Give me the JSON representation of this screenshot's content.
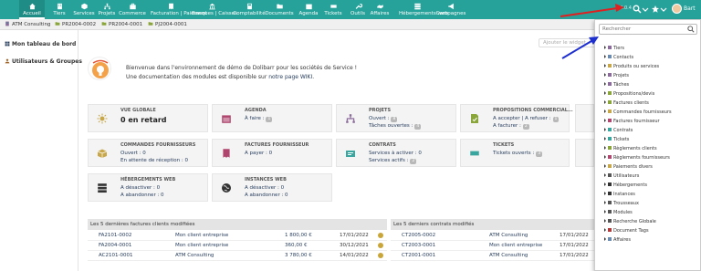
{
  "menu": [
    {
      "label": "Accueil",
      "icon": "home-icon",
      "active": true
    },
    {
      "label": "Tiers",
      "icon": "building-icon"
    },
    {
      "label": "Services",
      "icon": "cube-icon"
    },
    {
      "label": "Projets",
      "icon": "sitemap-icon"
    },
    {
      "label": "Commerce",
      "icon": "briefcase-icon"
    },
    {
      "label": "Facturation | Paiement",
      "icon": "invoice-icon"
    },
    {
      "label": "Banques | Caisses",
      "icon": "bank-icon"
    },
    {
      "label": "Comptabilité",
      "icon": "calculator-icon"
    },
    {
      "label": "Documents",
      "icon": "folder-icon"
    },
    {
      "label": "Agenda",
      "icon": "calendar-icon"
    },
    {
      "label": "Tickets",
      "icon": "ticket-icon"
    },
    {
      "label": "Outils",
      "icon": "wrench-icon"
    },
    {
      "label": "Affaires",
      "icon": "handshake-icon"
    },
    {
      "label": "Hébergements web",
      "icon": "server-icon"
    },
    {
      "label": "Campagnes",
      "icon": "megaphone-icon"
    }
  ],
  "topright": {
    "version": "14.0.4",
    "user": "Bart"
  },
  "breadcrumbs": [
    {
      "label": "ATM Consulting",
      "icon": "building-icon"
    },
    {
      "label": "PR2004-0002",
      "icon": "folder-icon"
    },
    {
      "label": "PR2004-0001",
      "icon": "folder-icon"
    },
    {
      "label": "PJ2004-0001",
      "icon": "folder-icon"
    }
  ],
  "left_menu": [
    {
      "label": "Mon tableau de bord",
      "icon": "dashboard-icon"
    },
    {
      "label": "Utilisateurs & Groupes",
      "icon": "user-icon"
    }
  ],
  "add_widget": "Ajouter le widget...",
  "welcome": {
    "line1": "Bienvenue dans l'environnement de démo de Dolibarr pour les sociétés de Service !",
    "line2_pre": "Une documentation des modules est disponible sur ",
    "line2_link": "notre page WIKI",
    "line2_post": "."
  },
  "cards_row1": [
    {
      "title": "VUE GLOBALE",
      "big": "0 en retard",
      "lines": [],
      "icon": "sun-icon",
      "color": "#c8a74a"
    },
    {
      "title": "AGENDA",
      "lines": [
        {
          "text": "À faire :",
          "badge": "1"
        }
      ],
      "icon": "calendar-icon",
      "color": "#b0466e"
    },
    {
      "title": "PROJETS",
      "lines": [
        {
          "text": "Ouvert :",
          "badge": "8"
        },
        {
          "text": "Tâches ouvertes :",
          "badge": "4"
        }
      ],
      "icon": "sitemap-icon",
      "color": "#8a6b9a"
    },
    {
      "title": "PROPOSITIONS COMMERCIAL...",
      "lines": [
        {
          "text": "A accepter | A refuser :",
          "badge": "1"
        },
        {
          "text": "A facturer :",
          "badge": "2"
        }
      ],
      "icon": "proposal-icon",
      "color": "#8aa63a"
    }
  ],
  "cards_row2": [
    {
      "title": "COMMANDES FOURNISSEURS",
      "lines": [
        {
          "text": "Ouvert : 0"
        },
        {
          "text": "En attente de réception : 0"
        }
      ],
      "icon": "box-icon",
      "color": "#c8a74a"
    },
    {
      "title": "FACTURES FOURNISSEUR",
      "lines": [
        {
          "text": "A payer : 0"
        }
      ],
      "icon": "invoice-icon",
      "color": "#b0466e"
    },
    {
      "title": "CONTRATS",
      "lines": [
        {
          "text": "Services à activer : 0"
        },
        {
          "text": "Services actifs :",
          "badge": "2"
        }
      ],
      "icon": "contract-icon",
      "color": "#3aa6a0"
    },
    {
      "title": "TICKETS",
      "lines": [
        {
          "text": "Tickets ouverts :",
          "badge": "3"
        }
      ],
      "icon": "ticket-icon",
      "color": "#3aa6a0"
    }
  ],
  "cards_row3": [
    {
      "title": "HÉBERGEMENTS WEB",
      "lines": [
        {
          "text": "A désactiver : 0"
        },
        {
          "text": "A abandonner : 0"
        }
      ],
      "icon": "server-icon",
      "color": "#333333"
    },
    {
      "title": "INSTANCES WEB",
      "lines": [
        {
          "text": "A désactiver : 0"
        },
        {
          "text": "A abandonner : 0"
        }
      ],
      "icon": "globe-icon",
      "color": "#333333"
    }
  ],
  "invoices": {
    "title": "Les 5 dernières factures clients modifiées",
    "rows": [
      {
        "ref": "FA2101-0002",
        "client": "Mon client entreprise",
        "amount": "1 800,00 €",
        "date": "17/01/2022"
      },
      {
        "ref": "FA2004-0001",
        "client": "Mon client entreprise",
        "amount": "360,00 €",
        "date": "30/12/2021"
      },
      {
        "ref": "AC2101-0001",
        "client": "ATM Consulting",
        "amount": "3 780,00 €",
        "date": "14/01/2022"
      }
    ]
  },
  "contracts": {
    "title": "Les 5 derniers contrats modifiés",
    "rows": [
      {
        "ref": "CT2005-0002",
        "client": "ATM Consulting",
        "date": "17/01/2022"
      },
      {
        "ref": "CT2003-0001",
        "client": "Mon client entreprise",
        "date": "17/01/2022"
      },
      {
        "ref": "CT2001-0001",
        "client": "ATM Consulting",
        "date": "17/01/2022"
      }
    ]
  },
  "search": {
    "placeholder": "Rechercher",
    "items": [
      {
        "label": "Tiers",
        "color": "#8a6b9a"
      },
      {
        "label": "Contacts",
        "color": "#6b8ab0"
      },
      {
        "label": "Produits ou services",
        "color": "#c8a74a"
      },
      {
        "label": "Projets",
        "color": "#8a6b9a"
      },
      {
        "label": "Tâches",
        "color": "#8a6b9a"
      },
      {
        "label": "Propositions/devis",
        "color": "#8aa63a"
      },
      {
        "label": "Factures clients",
        "color": "#8aa63a"
      },
      {
        "label": "Commandes fournisseurs",
        "color": "#c8a74a"
      },
      {
        "label": "Factures fournisseur",
        "color": "#b0466e"
      },
      {
        "label": "Contrats",
        "color": "#3aa6a0"
      },
      {
        "label": "Tickets",
        "color": "#3aa6a0"
      },
      {
        "label": "Règlements clients",
        "color": "#8aa63a"
      },
      {
        "label": "Règlements fournisseurs",
        "color": "#b0466e"
      },
      {
        "label": "Paiements divers",
        "color": "#c8a74a"
      },
      {
        "label": "Utilisateurs",
        "color": "#555555"
      },
      {
        "label": "Hébergements",
        "color": "#333333"
      },
      {
        "label": "Instances",
        "color": "#333333"
      },
      {
        "label": "Trousseaux",
        "color": "#555555"
      },
      {
        "label": "Modules",
        "color": "#555555"
      },
      {
        "label": "Recherche Globale",
        "color": "#555555"
      },
      {
        "label": "Document Tags",
        "color": "#b03a3a"
      },
      {
        "label": "Affaires",
        "color": "#6b8ab0"
      }
    ]
  }
}
